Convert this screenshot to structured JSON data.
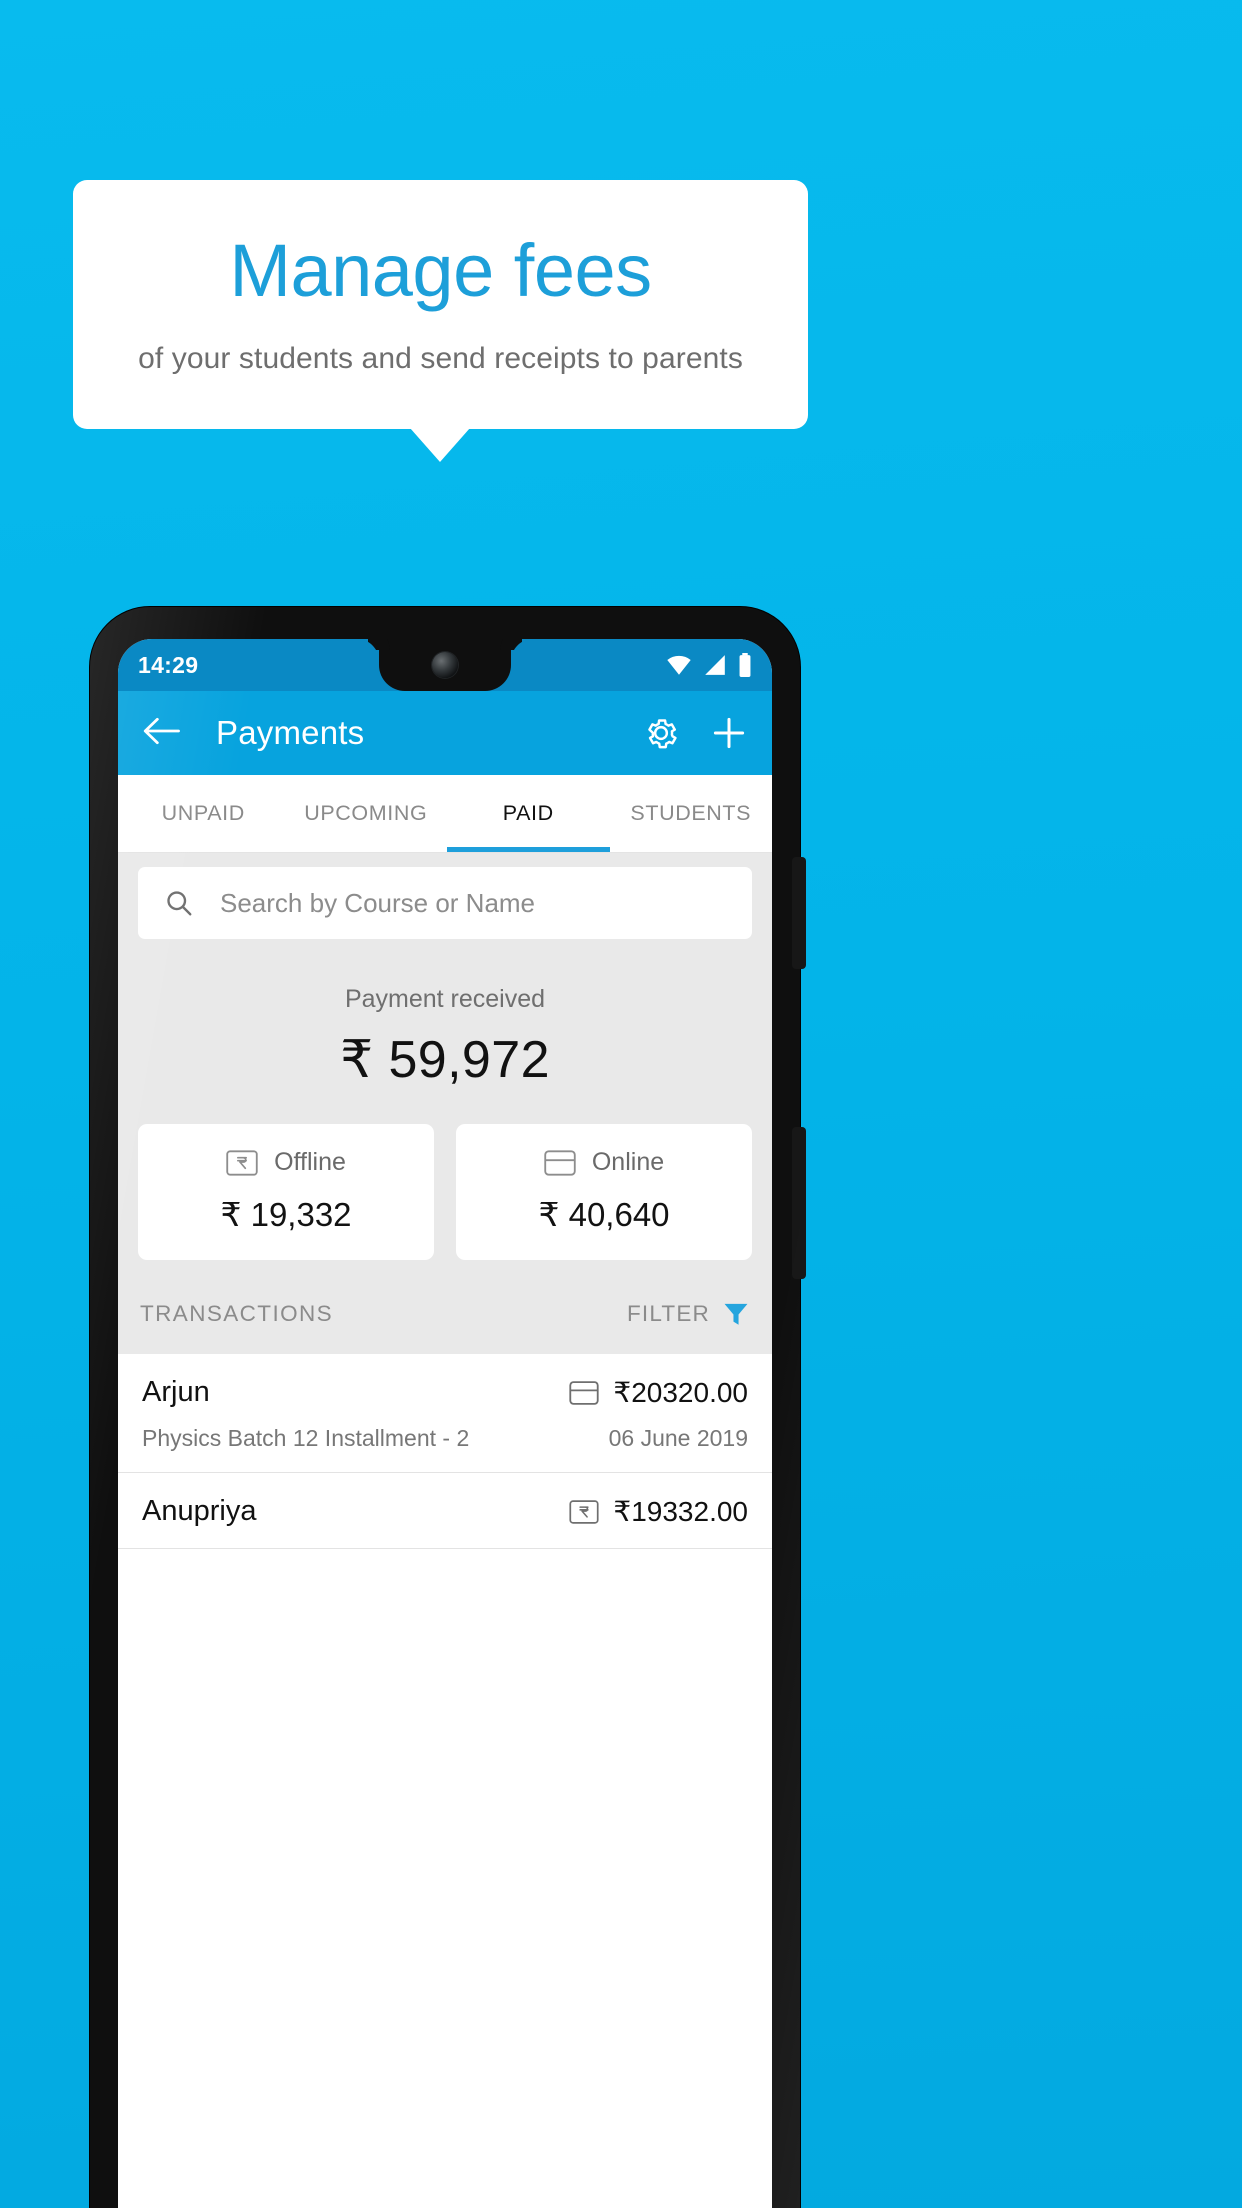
{
  "promo": {
    "headline": "Manage fees",
    "subhead": "of your students and send receipts to parents",
    "headline_color": "#1d9fd9",
    "background_color": "#05b8ec"
  },
  "phone": {
    "status_bar": {
      "time": "14:29",
      "icons": [
        "wifi-icon",
        "signal-icon",
        "battery-icon"
      ]
    },
    "app_bar": {
      "back_icon": "arrow-left-icon",
      "title": "Payments",
      "settings_icon": "gear-icon",
      "add_icon": "plus-icon"
    },
    "tabs": [
      {
        "label": "UNPAID",
        "active": false
      },
      {
        "label": "UPCOMING",
        "active": false
      },
      {
        "label": "PAID",
        "active": true
      },
      {
        "label": "STUDENTS",
        "active": false
      }
    ],
    "search": {
      "placeholder": "Search by Course or Name",
      "icon": "search-icon"
    },
    "summary": {
      "label": "Payment received",
      "amount": "₹ 59,972"
    },
    "method_cards": [
      {
        "icon": "rupee-note-icon",
        "label": "Offline",
        "amount": "₹ 19,332"
      },
      {
        "icon": "credit-card-icon",
        "label": "Online",
        "amount": "₹ 40,640"
      }
    ],
    "transactions_header": {
      "title": "TRANSACTIONS",
      "filter_label": "FILTER",
      "filter_icon": "filter-funnel-icon"
    },
    "transactions": [
      {
        "name": "Arjun",
        "description": "Physics Batch 12 Installment - 2",
        "amount": "₹20320.00",
        "date": "06 June 2019",
        "method_icon": "credit-card-icon"
      },
      {
        "name": "Anupriya",
        "description": "",
        "amount": "₹19332.00",
        "date": "",
        "method_icon": "rupee-note-icon"
      }
    ],
    "accent_color": "#07a3de",
    "tab_indicator_color": "#1e9fdb"
  }
}
